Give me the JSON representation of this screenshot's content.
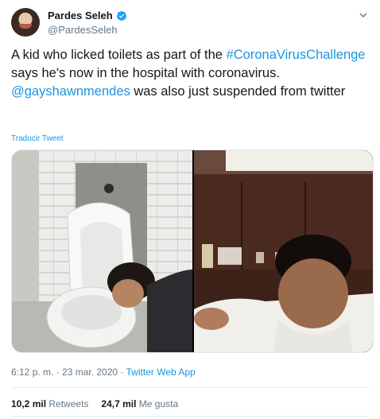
{
  "author": {
    "name": "Pardes Seleh",
    "handle": "@PardesSeleh",
    "verified_icon": "verified-badge-icon"
  },
  "tweet": {
    "text_1": "A kid who licked toilets as part of the",
    "hashtag": "#CoronaVirusChallenge",
    "text_2": " says he's now in the hospital with coronavirus. ",
    "mention": "@gayshawnmendes",
    "text_3": " was also just suspended from twitter",
    "translate_label": "Traducir Tweet"
  },
  "meta": {
    "timestamp": "6:12 p. m. · 23 mar. 2020",
    "separator": " · ",
    "app": "Twitter Web App"
  },
  "stats": {
    "retweets_count": "10,2 mil",
    "retweets_label": "Retweets",
    "likes_count": "24,7 mil",
    "likes_label": "Me gusta"
  },
  "colors": {
    "link": "#1b95e0",
    "secondary_text": "#657786",
    "primary_text": "#14171a"
  }
}
